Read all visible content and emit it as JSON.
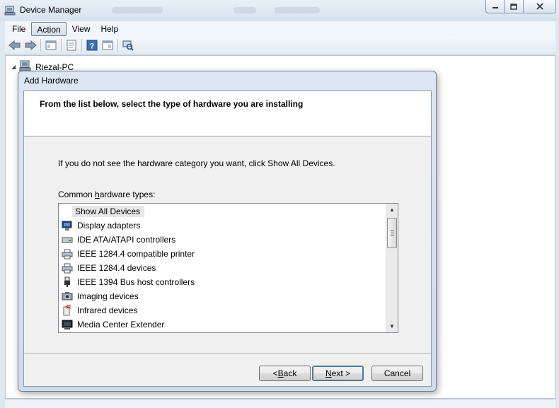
{
  "window": {
    "title": "Device Manager",
    "buttons": {
      "minimize": "▭",
      "maximize": "□",
      "close": "✕"
    }
  },
  "menubar": {
    "items": [
      "File",
      "Action",
      "View",
      "Help"
    ],
    "active": "Action"
  },
  "tree": {
    "root_label": "Riezal-PC"
  },
  "dialog": {
    "title": "Add Hardware",
    "heading": "From the list below, select the type of hardware you are installing",
    "hint": "If you do not see the hardware category you want, click Show All Devices.",
    "list_label_pre": "Common ",
    "list_label_underlined": "h",
    "list_label_post": "ardware types:",
    "list_items": [
      {
        "label": "Show All Devices",
        "icon": "none"
      },
      {
        "label": "Display adapters",
        "icon": "monitor-icon"
      },
      {
        "label": "IDE ATA/ATAPI controllers",
        "icon": "drive-icon"
      },
      {
        "label": "IEEE 1284.4 compatible printer",
        "icon": "printer-icon"
      },
      {
        "label": "IEEE 1284.4 devices",
        "icon": "printer-icon"
      },
      {
        "label": "IEEE 1394 Bus host controllers",
        "icon": "usb-plug-icon"
      },
      {
        "label": "Imaging devices",
        "icon": "camera-icon"
      },
      {
        "label": "Infrared devices",
        "icon": "infrared-icon"
      },
      {
        "label": "Media Center Extender",
        "icon": "monitor-icon"
      }
    ],
    "buttons": {
      "back_pre": "< ",
      "back_u": "B",
      "back_post": "ack",
      "next_u": "N",
      "next_post": "ext >",
      "cancel": "Cancel"
    }
  }
}
